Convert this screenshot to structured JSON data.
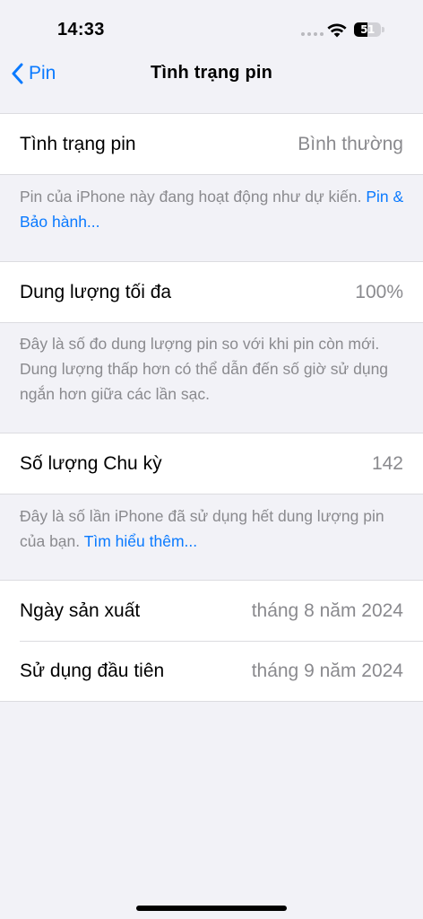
{
  "status_bar": {
    "time": "14:33",
    "battery_level": "51",
    "battery_fraction": 0.51,
    "signal_icon": "cellular-dots-icon",
    "wifi_icon": "wifi-icon"
  },
  "nav": {
    "back_label": "Pin",
    "back_icon": "chevron-left-icon",
    "title": "Tình trạng pin"
  },
  "sections": {
    "health": {
      "label": "Tình trạng pin",
      "value": "Bình thường",
      "footer_text": "Pin của iPhone này đang hoạt động như dự kiến.",
      "footer_link": "Pin & Bảo hành..."
    },
    "capacity": {
      "label": "Dung lượng tối đa",
      "value": "100%",
      "footer_text": "Đây là số đo dung lượng pin so với khi pin còn mới. Dung lượng thấp hơn có thể dẫn đến số giờ sử dụng ngắn hơn giữa các lần sạc."
    },
    "cycles": {
      "label": "Số lượng Chu kỳ",
      "value": "142",
      "footer_text": "Đây là số lần iPhone đã sử dụng hết dung lượng pin của bạn.",
      "footer_link": "Tìm hiểu thêm..."
    },
    "dates": {
      "manufacture_label": "Ngày sản xuất",
      "manufacture_value": "tháng 8 năm 2024",
      "first_use_label": "Sử dụng đầu tiên",
      "first_use_value": "tháng 9 năm 2024"
    }
  },
  "colors": {
    "accent": "#0a7aff",
    "background": "#f2f2f7",
    "secondary_text": "#8a8a8e"
  }
}
